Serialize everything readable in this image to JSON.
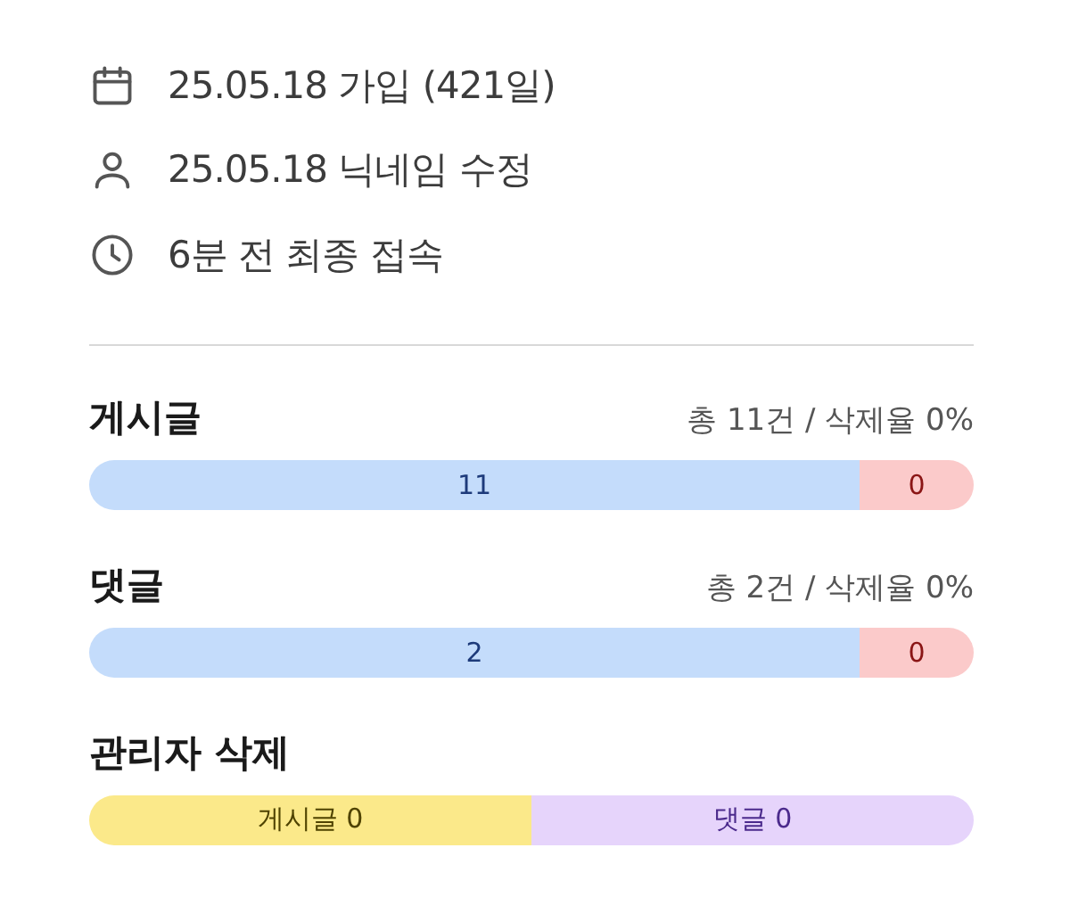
{
  "info": [
    {
      "kind": "calendar",
      "text": "25.05.18 가입 (421일)"
    },
    {
      "kind": "person",
      "text": "25.05.18 닉네임 수정"
    },
    {
      "kind": "clock",
      "text": "6분 전 최종 접속"
    }
  ],
  "stats": [
    {
      "title": "게시글",
      "summary": "총 11건 / 삭제율 0%",
      "segments": [
        {
          "kind": "main",
          "label": "11"
        },
        {
          "kind": "deleted",
          "label": "0"
        }
      ]
    },
    {
      "title": "댓글",
      "summary": "총 2건 / 삭제율 0%",
      "segments": [
        {
          "kind": "main",
          "label": "2"
        },
        {
          "kind": "deleted",
          "label": "0"
        }
      ]
    },
    {
      "title": "관리자 삭제",
      "segments": [
        {
          "kind": "posts",
          "label": "게시글 0"
        },
        {
          "kind": "comments",
          "label": "댓글 0"
        }
      ]
    }
  ]
}
